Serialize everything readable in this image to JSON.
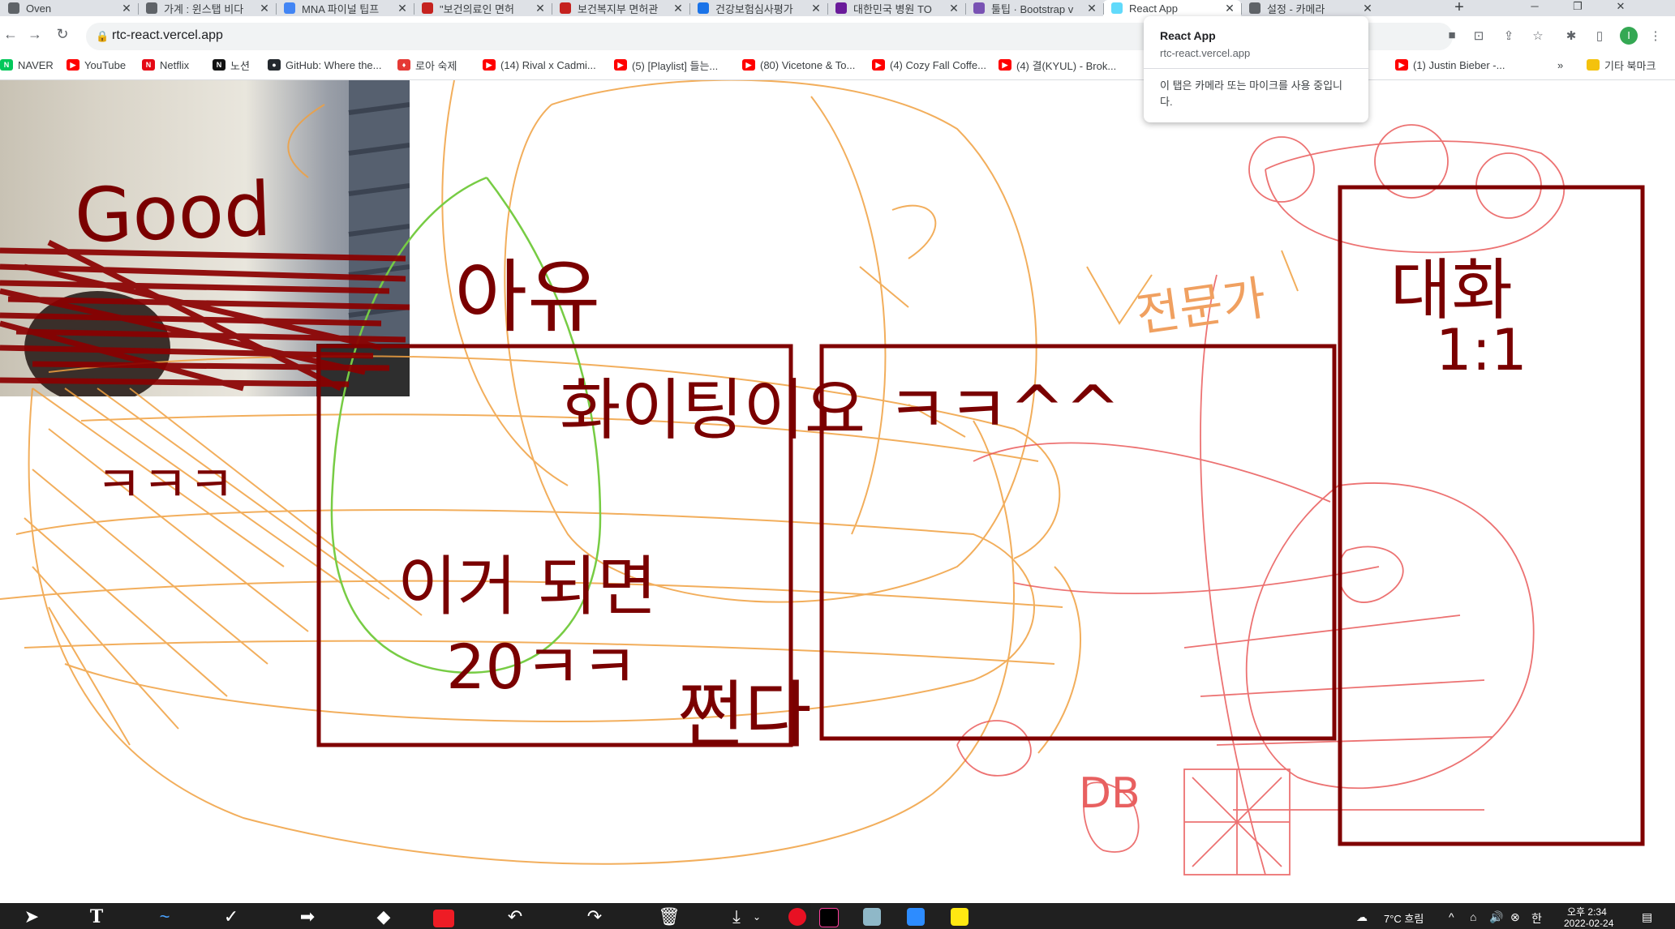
{
  "tabs": [
    {
      "title": "Oven",
      "icon": "oven-icon",
      "color": "#5f6368"
    },
    {
      "title": "가계 : 윈스탭 비다",
      "icon": "page-icon",
      "color": "#5f6368"
    },
    {
      "title": "MNA 파이널 팁프",
      "icon": "ppt-icon",
      "color": "#4285f4"
    },
    {
      "title": "\"보건의료인 면허",
      "icon": "chrome-icon",
      "color": "#c5221f"
    },
    {
      "title": "보건복지부 면허관",
      "icon": "chrome-icon",
      "color": "#c5221f"
    },
    {
      "title": "건강보험심사평가",
      "icon": "d-icon",
      "color": "#1a73e8"
    },
    {
      "title": "대한민국 병원 TO",
      "icon": "site-icon",
      "color": "#6a1b9a"
    },
    {
      "title": "툴팁 · Bootstrap v",
      "icon": "bootstrap-icon",
      "color": "#7952b3"
    },
    {
      "title": "React App",
      "icon": "react-icon",
      "color": "#61dafb"
    },
    {
      "title": "설정 - 카메라",
      "icon": "gear-icon",
      "color": "#5f6368"
    }
  ],
  "url": "rtc-react.vercel.app",
  "bookmarks": [
    {
      "label": "NAVER",
      "color": "#03c75a",
      "glyph": "N"
    },
    {
      "label": "YouTube",
      "color": "#ff0000",
      "glyph": "▶"
    },
    {
      "label": "Netflix",
      "color": "#e50914",
      "glyph": "N"
    },
    {
      "label": "노션",
      "color": "#111111",
      "glyph": "N"
    },
    {
      "label": "GitHub: Where the...",
      "color": "#24292e",
      "glyph": "●"
    },
    {
      "label": "로아 숙제",
      "color": "#e53935",
      "glyph": "♦"
    },
    {
      "label": "(14) Rival x Cadmi...",
      "color": "#ff0000",
      "glyph": "▶"
    },
    {
      "label": "(5) [Playlist] 들는...",
      "color": "#ff0000",
      "glyph": "▶"
    },
    {
      "label": "(80) Vicetone & To...",
      "color": "#ff0000",
      "glyph": "▶"
    },
    {
      "label": "(4) Cozy Fall Coffe...",
      "color": "#ff0000",
      "glyph": "▶"
    },
    {
      "label": "(4) 결(KYUL) - Brok...",
      "color": "#ff0000",
      "glyph": "▶"
    },
    {
      "label": "(1) Justin Bieber -...",
      "color": "#ff0000",
      "glyph": "▶"
    }
  ],
  "bookmarks_more": "»",
  "other_bookmarks": "기타 북마크",
  "popup": {
    "title": "React App",
    "url": "rtc-react.vercel.app",
    "message": "이 탭은 카메라 또는 마이크를 사용 중입니다."
  },
  "drawing": {
    "good": "Good",
    "ayu": "아유",
    "fighting": "화이팅이요 ㅋㅋ^^",
    "kkk": "ㅋㅋㅋ",
    "if_this_works": "이거 되면",
    "twenty": "20ㅋㅋ",
    "jjeonda": "쩐다",
    "daehwa": "대화",
    "one_one": "1:1",
    "jeonmunga": "전문가",
    "db": "DB"
  },
  "profile_initial": "I",
  "tray": {
    "weather": "7°C 흐림",
    "time": "오후 2:34",
    "date": "2022-02-24"
  }
}
